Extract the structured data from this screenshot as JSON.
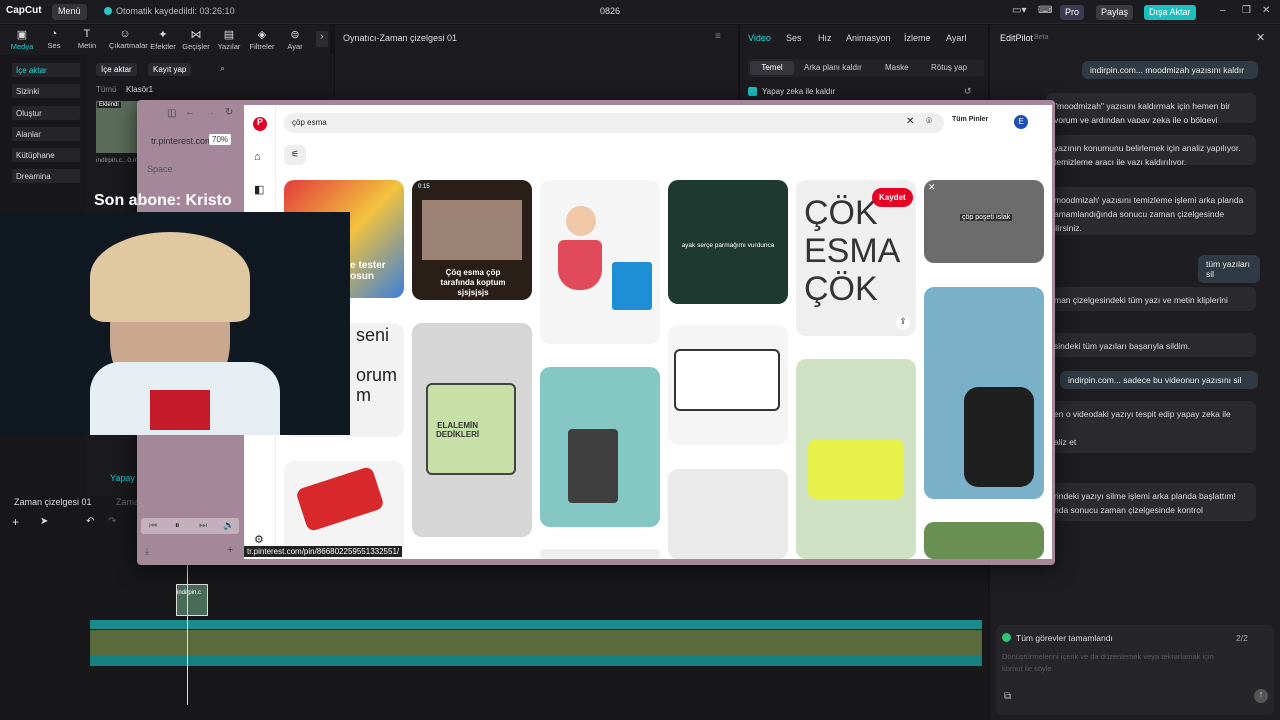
{
  "app": {
    "logo": "CapCut",
    "menu": "Menü",
    "autosave": "Otomatik kaydedildi: 03:26:10",
    "project": "0826",
    "pro": "Pro",
    "share": "Paylaş",
    "export": "Dışa Aktar"
  },
  "tools": [
    "Medya",
    "Ses",
    "Metin",
    "Çıkartmalar",
    "Efektler",
    "Geçişler",
    "Yazılar",
    "Filtreler",
    "Ayar"
  ],
  "leftnav": [
    "İçe aktar",
    "Sizinki",
    "Oluştur",
    "Alanlar",
    "Kütüphane",
    "Dreamina"
  ],
  "media": {
    "import": "İçe aktar",
    "record": "Kayıt yap",
    "crumb_all": "Tümü",
    "crumb_folder": "Klasör1",
    "added": "Eklendi",
    "file": "indirpin.c...0.mp4",
    "caption": "Son abone: Kristo",
    "yapay": "Yapay z"
  },
  "player": {
    "title": "Oynatıcı-Zaman çizelgesi 01"
  },
  "inspector": {
    "tabs": [
      "Video",
      "Ses",
      "Hız",
      "Animasyon",
      "İzleme",
      "Ayarl"
    ],
    "subtabs": [
      "Temel",
      "Arka planı kaldır",
      "Maske",
      "Rötuş yap"
    ],
    "ai": "Yapay zeka ile kaldır"
  },
  "editpilot": {
    "title": "EditPilot",
    "beta": "Beta",
    "user1_src": "indirpin.com...",
    "user1": "moodmizah yazısını kaldır",
    "a1": "\"moodmizah\" yazısını kaldırmak için hemen bir\nyorum ve ardından yapay zeka ile o bölgeyi",
    "a2": "yazının konumunu belirlemek için analiz yapılıyor.\n temizleme aracı ile yazı kaldırılıyor.",
    "a3": "moodmizah' yazısını temizleme işlemi arka planda\namamlandığında sonucu zaman çizelgesinde\nilirsiniz.",
    "user2": "tüm yazıları sil",
    "a4": "man çizelgesindeki tüm yazı ve metin kliplerini",
    "a5": "sindeki tüm yazıları başarıyla sildim.",
    "user3_src": "indirpin.com...",
    "user3": "sadece bu videonun yazısını sil",
    "a6": "en o videodaki yazıyı tespit edip yapay zeka ile\n\naliz et",
    "a7": "rindeki yazıyı silme işlemi arka planda başlattım!\nnda sonucu zaman çizelgesinde kontrol",
    "tasks": "Tüm görevler tamamlandı",
    "tasks_count": "2/2",
    "input_placeholder": "Dönüştürmelerini içerik ve da düzenlemek veya tekrarlamak için komut ile söyle."
  },
  "timeline": {
    "tab": "Zaman çizelgesi 01",
    "tab2": "Zaman",
    "clip": "indirpin.c"
  },
  "browser": {
    "url": "tr.pinterest.com",
    "zoom": "70%",
    "space": "Space",
    "search": "çöp esma",
    "all_pins": "Tüm Pinler",
    "avatar": "E",
    "hover_url": "tr.pinterest.com/pin/866802259551332551/",
    "save": "Kaydet"
  },
  "pins": {
    "p1": "de tester\ngosun",
    "p2a": "0:15",
    "p2b": "Çöq esma çöp\ntarafında koptum\nsjsjsjsjs",
    "p3": "ayak serçe parmağımı vurdunca",
    "p4": "ÇÖK\nESMA\nÇÖK",
    "p5": "çöp poşeti ıslak",
    "p6": "seni\n\norum\nm",
    "p7": "ELALEMİN\nDEDİKLERİ"
  }
}
